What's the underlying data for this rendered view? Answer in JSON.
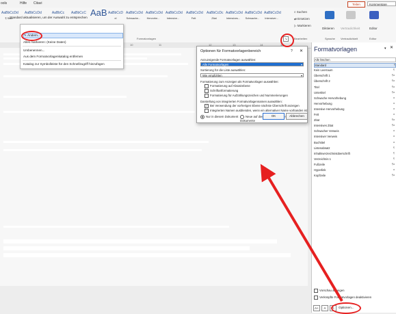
{
  "menubar": {
    "tools": "ools",
    "help": "Hilfe",
    "citavi": "Citavi",
    "share": "Teilen",
    "comments": "Kommentare"
  },
  "ribbon": {
    "gallery": [
      {
        "preview": "AaBbCcDd",
        "name": "¶ Stan"
      },
      {
        "preview": "AaBbCcDd",
        "name": ""
      },
      {
        "preview": "AaBbCc",
        "name": ""
      },
      {
        "preview": "AaBbCcC",
        "name": ""
      },
      {
        "preview": "AaB",
        "name": ""
      },
      {
        "preview": "AaBbCcD",
        "name": "el"
      },
      {
        "preview": "AaBbCcDd",
        "name": "Schwache..."
      },
      {
        "preview": "AaBbCcDd",
        "name": "Hervorhe..."
      },
      {
        "preview": "AaBbCcDd",
        "name": "Intensive..."
      },
      {
        "preview": "AaBbCcDd",
        "name": "Fett"
      },
      {
        "preview": "AaBbCcDc",
        "name": "Zitat"
      },
      {
        "preview": "AaBbCcDd",
        "name": "Intensives..."
      },
      {
        "preview": "AaBbCcDd",
        "name": "Schwache..."
      },
      {
        "preview": "AaBbCcDd",
        "name": "Intensiver..."
      }
    ],
    "styles_group": "Formatvorlagen",
    "find": "Suchen",
    "replace": "Ersetzen",
    "select": "Markieren",
    "edit_group": "Bearbeiten",
    "dictate": "Diktieren",
    "speech_group": "Sprache",
    "confidentiality": "Vertraulichkeit",
    "confidentiality_group": "Vertraulichkeit",
    "editor": "Editor",
    "editor_group": "Editor",
    "launcher": "↘"
  },
  "ruler": [
    "9",
    "10",
    "11",
    "12",
    "13",
    "14",
    "15"
  ],
  "dropdown": {
    "tooltip": "Standard aktualisieren, um der Auswahl zu entsprechen",
    "items": [
      "Ändern...",
      "Alles markieren: (Keine Daten)",
      "Umbenennen...",
      "Aus dem Formatvorlagenkatalog entfernen",
      "Katalog zur Symbolleiste für den Schnellzugriff hinzufügen"
    ]
  },
  "dialog": {
    "title": "Optionen für Formatvorlagenbereich",
    "help": "?",
    "close": "✕",
    "lbl_show": "Anzuzeigende Formatvorlagen auswählen:",
    "sel_show": "Alle Formatvorlagen",
    "lbl_sort": "Sortierung für die Liste auswählen:",
    "sel_sort": "Wie empfohlen",
    "lbl_formatting": "Formatierung zum Anzeigen als Formatvorlagen auswählen:",
    "chk_paragraph": "Formatierung auf Absatzebene",
    "chk_font": "Schriftartformatierung",
    "chk_bullets": "Formatierung für Aufzählungszeichen und Nummerierungen",
    "lbl_builtin": "Darstellung von integrierten Formatvorlagennamen auswählen:",
    "chk_nextheading": "Bei Verwendung der vorherigen Ebene nächste Überschrift anzeigen",
    "chk_hidealt": "Integrierten Namen ausblenden, wenn ein alternativer Name vorhanden ist",
    "radio_doc": "Nur in diesem Dokument",
    "radio_template": "Neue auf dieser Vorlage basierende Dokumente",
    "ok": "OK",
    "cancel": "Abbrechen"
  },
  "pane": {
    "title": "Formatvorlagen",
    "dd": "▾",
    "close": "✕",
    "items": [
      {
        "label": "Alle löschen",
        "sym": ""
      },
      {
        "label": "Standard",
        "sym": "¶"
      },
      {
        "label": "Kein Leerraum",
        "sym": "¶"
      },
      {
        "label": "Überschrift 1",
        "sym": "¶a"
      },
      {
        "label": "Überschrift 2",
        "sym": "¶a"
      },
      {
        "label": "Titel",
        "sym": "¶a"
      },
      {
        "label": "Untertitel",
        "sym": "¶a"
      },
      {
        "label": "Schwache Hervorhebung",
        "sym": "a"
      },
      {
        "label": "Hervorhebung",
        "sym": "a"
      },
      {
        "label": "Intensive Hervorhebung",
        "sym": "a"
      },
      {
        "label": "Fett",
        "sym": "a"
      },
      {
        "label": "Zitat",
        "sym": "¶a"
      },
      {
        "label": "Intensives Zitat",
        "sym": "¶a"
      },
      {
        "label": "Schwacher Verweis",
        "sym": "a"
      },
      {
        "label": "Intensiver Verweis",
        "sym": "a"
      },
      {
        "label": "Buchtitel",
        "sym": "a"
      },
      {
        "label": "Listenabsatz",
        "sym": "¶"
      },
      {
        "label": "Inhaltsverzeichnisüberschrift",
        "sym": "¶"
      },
      {
        "label": "Verzeichnis 1",
        "sym": "¶"
      },
      {
        "label": "Fußzeile",
        "sym": "¶a"
      },
      {
        "label": "Hyperlink",
        "sym": "a"
      },
      {
        "label": "Kopfzeile",
        "sym": "¶a"
      }
    ],
    "preview_chk": "Vorschau anzeigen",
    "linked_chk": "Verknüpfte Formatvorlagen deaktivieren",
    "icons": [
      "A+",
      "A",
      "A"
    ],
    "options": "Optionen..."
  }
}
